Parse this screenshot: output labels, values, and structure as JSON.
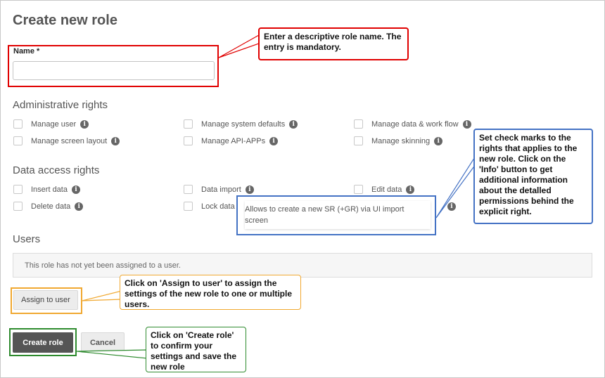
{
  "page": {
    "title": "Create new role"
  },
  "name_field": {
    "label": "Name",
    "required_marker": "*",
    "value": ""
  },
  "admin_rights": {
    "heading": "Administrative rights",
    "items": [
      {
        "label": "Manage user",
        "checked": false
      },
      {
        "label": "Manage system defaults",
        "checked": false
      },
      {
        "label": "Manage data & work flow",
        "checked": false
      },
      {
        "label": "Manage screen layout",
        "checked": false
      },
      {
        "label": "Manage API-APPs",
        "checked": false
      },
      {
        "label": "Manage skinning",
        "checked": false
      }
    ]
  },
  "data_rights": {
    "heading": "Data access rights",
    "items": [
      {
        "label": "Insert data",
        "checked": false
      },
      {
        "label": "Data import",
        "checked": false
      },
      {
        "label": "Edit data",
        "checked": false
      },
      {
        "label": "Delete data",
        "checked": false
      },
      {
        "label": "Lock data",
        "checked": false
      }
    ]
  },
  "tooltip": {
    "text": "Allows to create a new SR (+GR) via UI import screen"
  },
  "users": {
    "heading": "Users",
    "empty_text": "This role has not yet been assigned to a user.",
    "assign_label": "Assign to user"
  },
  "footer": {
    "create_label": "Create role",
    "cancel_label": "Cancel"
  },
  "annotations": {
    "name": "Enter a descriptive role name. The entry is mandatory.",
    "rights": "Set check marks to the rights that applies to the new role. Click on the 'Info' button to get additional information about the detalled permissions behind the explicit right.",
    "assign": "Click on 'Assign to user' to assign the settings of the new role to one or multiple users.",
    "create": "Click on 'Create role' to confirm your settings and save the new role"
  },
  "colors": {
    "red": "#e00000",
    "blue": "#4472c4",
    "orange": "#f0a830",
    "green": "#2e8b2e"
  },
  "icons": {
    "info": "info-icon"
  }
}
